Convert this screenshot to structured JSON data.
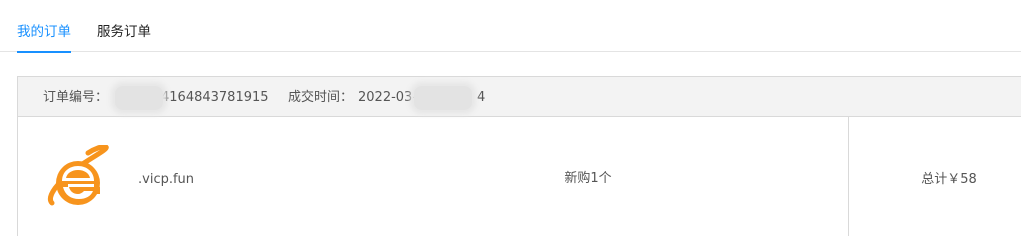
{
  "tabs": {
    "my_orders": "我的订单",
    "service_orders": "服务订单"
  },
  "order": {
    "order_no_label": "订单编号：",
    "order_no_visible": "4164843781915",
    "deal_time_label": "成交时间：",
    "deal_time_visible": "2022-03-",
    "deal_time_tail": "4",
    "product_icon": "internet-explorer-icon",
    "domain": ".vicp.fun",
    "purchase": "新购1个",
    "total": "总计￥58"
  },
  "colors": {
    "accent": "#1890ff",
    "header_bg": "#f3f3f3",
    "icon_orange": "#f7941d"
  }
}
